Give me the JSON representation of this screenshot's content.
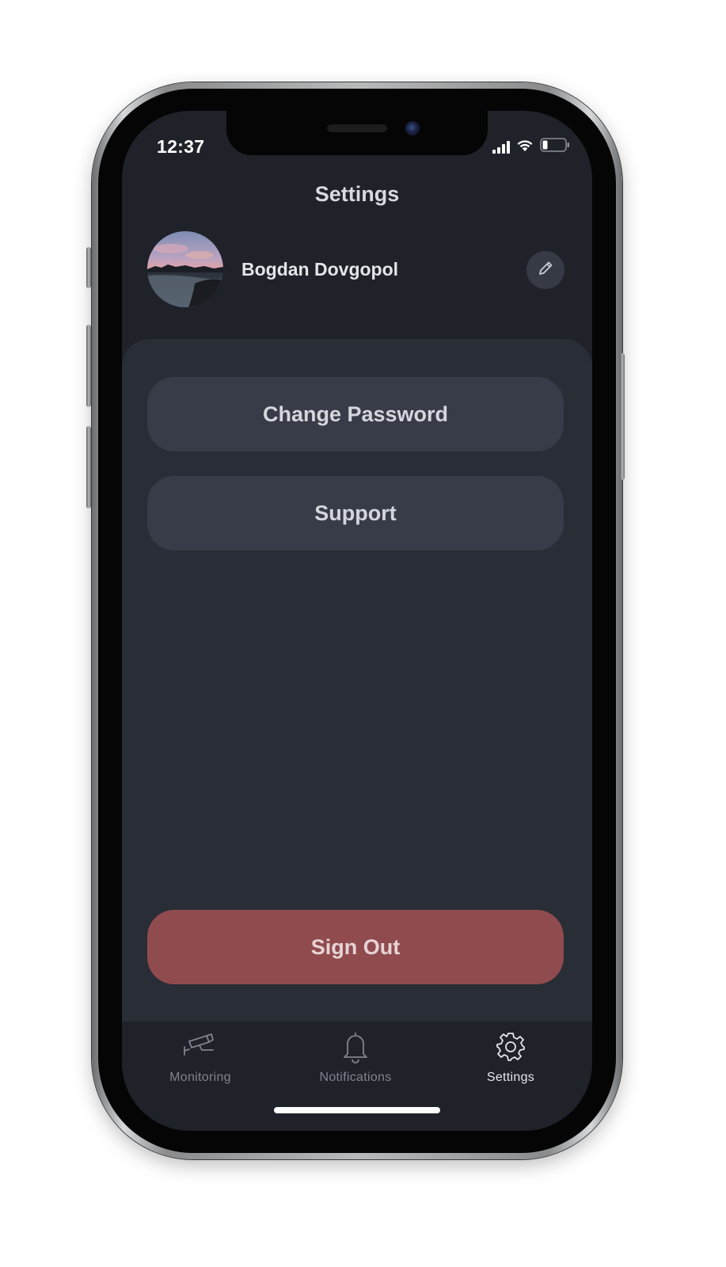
{
  "status_bar": {
    "time": "12:37"
  },
  "header": {
    "title": "Settings"
  },
  "profile": {
    "name": "Bogdan Dovgopol",
    "edit_icon": "pencil-icon"
  },
  "menu": {
    "items": [
      {
        "label": "Change Password"
      },
      {
        "label": "Support"
      }
    ]
  },
  "sign_out": {
    "label": "Sign Out"
  },
  "tab_bar": {
    "tabs": [
      {
        "label": "Monitoring",
        "icon": "security-camera-icon",
        "active": false
      },
      {
        "label": "Notifications",
        "icon": "bell-icon",
        "active": false
      },
      {
        "label": "Settings",
        "icon": "gear-icon",
        "active": true
      }
    ]
  },
  "colors": {
    "background": "#1f2229",
    "panel": "#292d35",
    "button": "#373c48",
    "sign_out": "#904b4e"
  }
}
